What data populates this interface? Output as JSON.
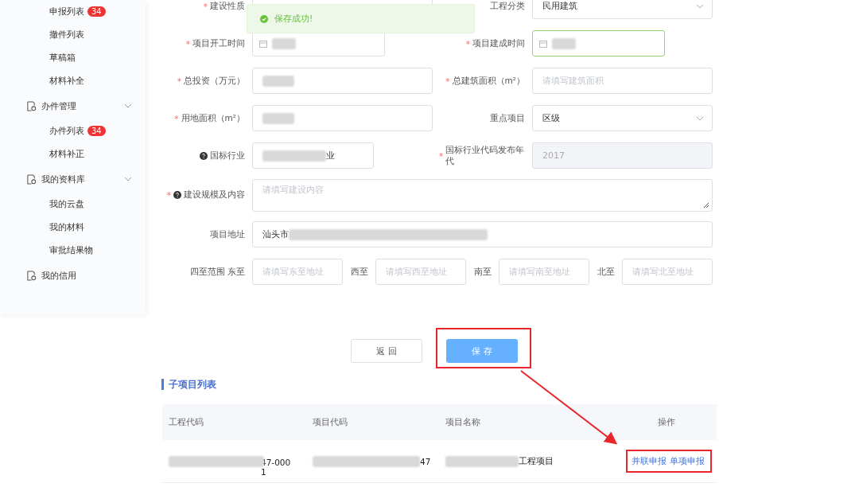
{
  "sidebar": {
    "items": [
      {
        "kind": "item",
        "label": "申报列表",
        "badge": "34"
      },
      {
        "kind": "item",
        "label": "撤件列表"
      },
      {
        "kind": "item",
        "label": "草稿箱"
      },
      {
        "kind": "item",
        "label": "材料补全"
      },
      {
        "kind": "group",
        "label": "办件管理",
        "expanded": true,
        "children": [
          {
            "kind": "item",
            "label": "办件列表",
            "badge": "34"
          },
          {
            "kind": "item",
            "label": "材料补正"
          }
        ]
      },
      {
        "kind": "group",
        "label": "我的资料库",
        "expanded": true,
        "children": [
          {
            "kind": "item",
            "label": "我的云盘"
          },
          {
            "kind": "item",
            "label": "我的材料"
          },
          {
            "kind": "item",
            "label": "审批结果物"
          }
        ]
      },
      {
        "kind": "link",
        "label": "我的信用"
      }
    ]
  },
  "toast": {
    "kind": "success",
    "text": "保存成功!"
  },
  "form": {
    "rows": [
      [
        {
          "label": "建设性质",
          "required": "*",
          "kind": "select"
        },
        {
          "label": "工程分类",
          "kind": "select",
          "value": "民用建筑"
        }
      ],
      [
        {
          "label": "项目开工时间",
          "required": "*",
          "kind": "date",
          "redacted": true
        },
        {
          "label": "项目建成时间",
          "required": "*",
          "kind": "date",
          "redacted": true,
          "focused": true
        }
      ],
      [
        {
          "label": "总投资（万元）",
          "required": "*",
          "kind": "text",
          "redacted": true
        },
        {
          "label": "总建筑面积（m²）",
          "required": "*",
          "kind": "text",
          "placeholder": "请填写建筑面积"
        }
      ],
      [
        {
          "label": "用地面积（m²）",
          "required": "*",
          "kind": "text",
          "redacted": true
        },
        {
          "label": "重点项目",
          "kind": "select",
          "value": "区级"
        }
      ],
      [
        {
          "label": "国标行业",
          "help": true,
          "kind": "short",
          "redacted": true,
          "value": "业"
        },
        {
          "label": "国标行业代码发布年代",
          "required": "*",
          "kind": "text",
          "disabled": true,
          "value": "2017"
        }
      ],
      [
        {
          "label": "建设规模及内容",
          "required": "*",
          "help": true,
          "kind": "textarea",
          "placeholder": "请填写建设内容"
        }
      ],
      [
        {
          "label": "项目地址",
          "kind": "text",
          "value": "汕头市",
          "redacted": true
        }
      ]
    ],
    "bounds": {
      "label": "四至范围 东至",
      "fields": [
        {
          "placeholder": "请填写东至地址"
        },
        {
          "label": "西至",
          "placeholder": "请填写西至地址"
        },
        {
          "label": "南至",
          "placeholder": "请填写南至地址"
        },
        {
          "label": "北至",
          "placeholder": "请填写北至地址"
        }
      ]
    }
  },
  "buttons": [
    {
      "kind": "default",
      "label": "返 回"
    },
    {
      "kind": "primary",
      "label": "保 存"
    }
  ],
  "subprojects": {
    "title": "子项目列表",
    "columns": [
      "工程代码",
      "项目代码",
      "项目名称",
      "操作"
    ],
    "rows": [
      {
        "engineering_code": "47-000\n1",
        "project_code": "47",
        "project_name": "工程项目",
        "actions": [
          "并联申报",
          "单项申报"
        ]
      }
    ]
  }
}
